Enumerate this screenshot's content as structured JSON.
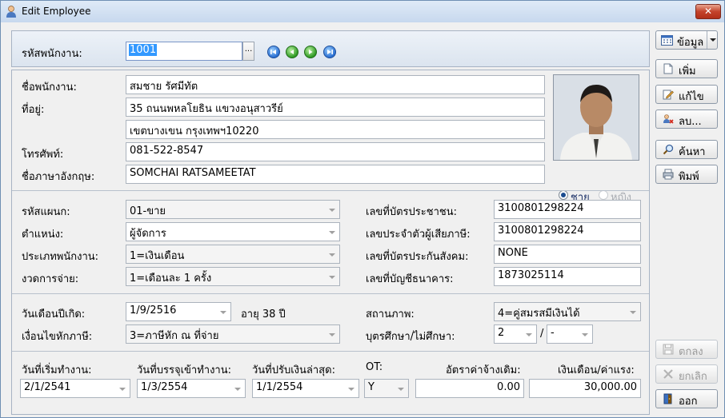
{
  "window": {
    "title": "Edit Employee",
    "close_label": "✕"
  },
  "header": {
    "emp_code_label": "รหัสพนักงาน:",
    "emp_code_value": "1001",
    "lookup_label": "..."
  },
  "person": {
    "name_label": "ชื่อพนักงาน:",
    "name_value": "สมชาย รัศมีทัต",
    "address_label": "ที่อยู่:",
    "address1": "35 ถนนพหลโยธิน แขวงอนุสาวรีย์",
    "address2": "เขตบางเขน กรุงเทพฯ10220",
    "phone_label": "โทรศัพท์:",
    "phone_value": "081-522-8547",
    "eng_name_label": "ชื่อภาษาอังกฤษ:",
    "eng_name_value": "SOMCHAI RATSAMEETAT",
    "gender_male": "ชาย",
    "gender_female": "หญิง"
  },
  "job": {
    "dept_label": "รหัสแผนก:",
    "dept_value": "01-ขาย",
    "position_label": "ตำแหน่ง:",
    "position_value": "ผู้จัดการ",
    "emp_type_label": "ประเภทพนักงาน:",
    "emp_type_value": "1=เงินเดือน",
    "pay_period_label": "งวดการจ่าย:",
    "pay_period_value": "1=เดือนละ 1 ครั้ง",
    "id_card_label": "เลขที่บัตรประชาชน:",
    "id_card_value": "3100801298224",
    "tax_id_label": "เลขประจำตัวผู้เสียภาษี:",
    "tax_id_value": "3100801298224",
    "social_sec_label": "เลขที่บัตรประกันสังคม:",
    "social_sec_value": "NONE",
    "bank_acct_label": "เลขที่บัญชีธนาคาร:",
    "bank_acct_value": "1873025114"
  },
  "personal": {
    "birth_label": "วันเดือนปีเกิด:",
    "birth_value": "1/9/2516",
    "age_text": "อายุ 38 ปี",
    "tax_cond_label": "เงื่อนไขหักภาษี:",
    "tax_cond_value": "3=ภาษีหัก ณ ที่จ่าย",
    "status_label": "สถานภาพ:",
    "status_value": "4=คู่สมรสมีเงินได้",
    "children_label": "บุตรศึกษา/ไม่ศึกษา:",
    "children_study": "2",
    "children_slash": "/",
    "children_nostudy": "-"
  },
  "employment": {
    "start_label": "วันที่เริ่มทำงาน:",
    "start_value": "2/1/2541",
    "perm_label": "วันที่บรรจุเข้าทำงาน:",
    "perm_value": "1/3/2554",
    "raise_label": "วันที่ปรับเงินล่าสุด:",
    "raise_value": "1/1/2554",
    "ot_label": "OT:",
    "ot_value": "Y",
    "orig_wage_label": "อัตราค่าจ้างเดิม:",
    "orig_wage_value": "0.00",
    "salary_label": "เงินเดือน/ค่าแรง:",
    "salary_value": "30,000.00"
  },
  "side": {
    "info_label": "ข้อมูล",
    "add_label": "เพิ่ม",
    "edit_label": "แก้ไข",
    "delete_label": "ลบ...",
    "search_label": "ค้นหา",
    "print_label": "พิมพ์",
    "ok_label": "ตกลง",
    "cancel_label": "ยกเลิก",
    "exit_label": "ออก"
  },
  "colors": {
    "accent": "#3399ff",
    "titlebar": "#c7d8ee",
    "close": "#c4432b"
  }
}
